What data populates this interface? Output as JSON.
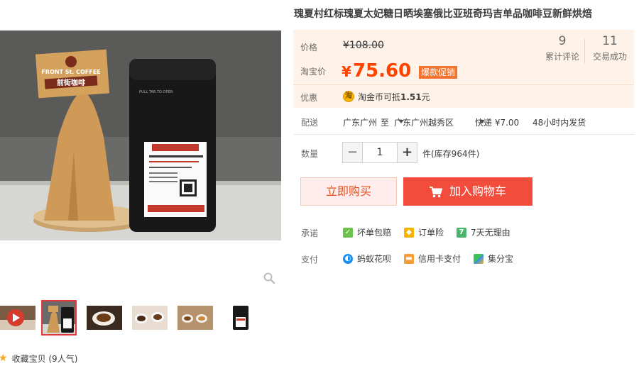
{
  "product": {
    "title": "瑰夏村红标瑰夏太妃糖日晒埃塞俄比亚班奇玛吉单品咖啡豆新鲜烘焙"
  },
  "gallery": {
    "image_label": "FRONT St. COFFEE",
    "image_label_cn": "前街咖啡",
    "favorite_label": "收藏宝贝 (9人气)",
    "thumbnails": [
      "video",
      "product-bag-stand",
      "coffee-cup",
      "coffee-beans-cups",
      "coffee-tasting",
      "product-bag"
    ]
  },
  "price": {
    "label": "价格",
    "original": "¥108.00",
    "taobao_label": "淘宝价",
    "currency": "¥",
    "value": "75.60",
    "promo_badge": "爆款促销"
  },
  "stats": {
    "reviews_count": "9",
    "reviews_label": "累计评论",
    "deals_count": "11",
    "deals_label": "交易成功"
  },
  "coupon": {
    "label": "优惠",
    "coin_glyph": "淘",
    "text_prefix": "淘金币可抵",
    "amount": "1.51",
    "unit": "元"
  },
  "delivery": {
    "label": "配送",
    "from": "广东广州",
    "to_word": "至",
    "to": "广东广州越秀区",
    "method": "快递 ¥7.00",
    "ship_time": "48小时内发货"
  },
  "quantity": {
    "label": "数量",
    "minus": "−",
    "value": "1",
    "plus": "+",
    "stock": "件(库存964件)"
  },
  "actions": {
    "buy_now": "立即购买",
    "add_to_cart": "加入购物车"
  },
  "guarantee": {
    "label": "承诺",
    "items": [
      "坏单包赔",
      "订单险",
      "7天无理由"
    ],
    "icon_glyphs": [
      "",
      "",
      "7"
    ]
  },
  "payment": {
    "label": "支付",
    "items": [
      "蚂蚁花呗",
      "信用卡支付",
      "集分宝"
    ]
  },
  "colors": {
    "price": "#ff4400",
    "promo_badge": "#f0742f",
    "cart_button": "#f24c3c",
    "buy_button_bg": "#ffeded",
    "price_box_bg": "#fff2e8"
  }
}
